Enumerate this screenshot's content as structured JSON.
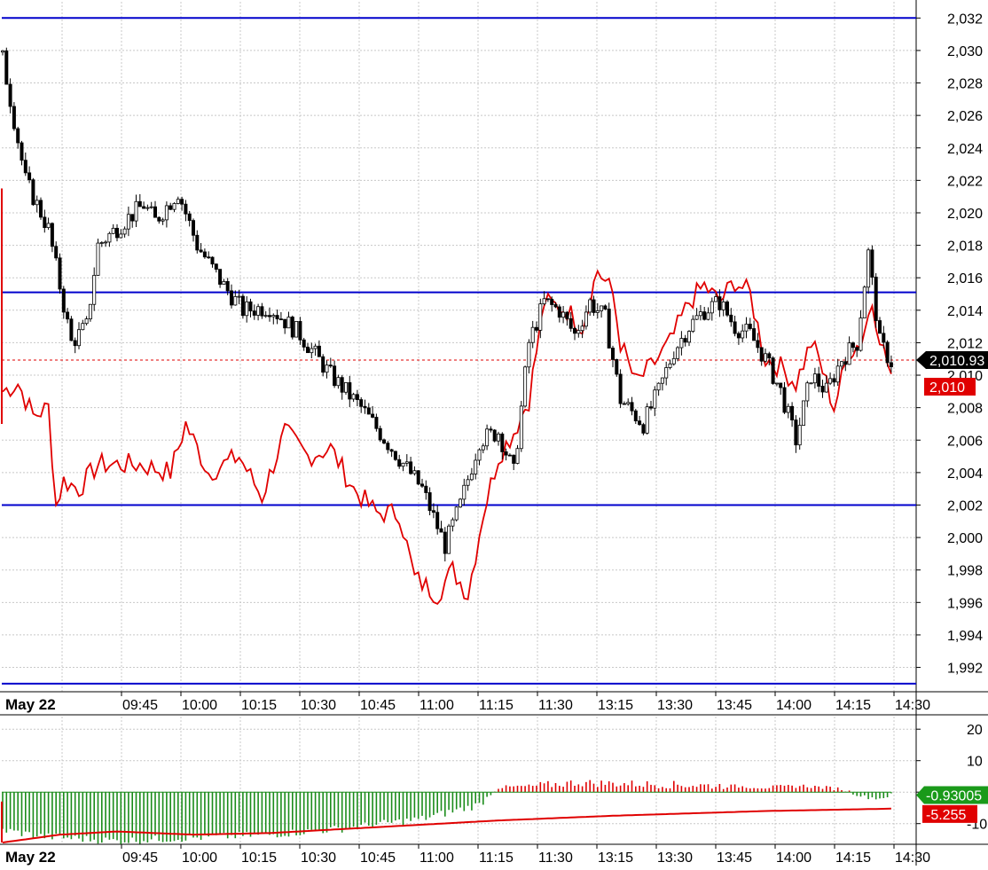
{
  "chart_data": [
    {
      "type": "candlestick",
      "panel": "price",
      "date_label": "May 22",
      "x_tick_labels": [
        "09:45",
        "10:00",
        "10:15",
        "10:30",
        "10:45",
        "11:00",
        "11:15",
        "11:30",
        "13:15",
        "13:30",
        "13:45",
        "14:00",
        "14:15",
        "14:30"
      ],
      "y_tick_labels": [
        "2,032",
        "2,030",
        "2,028",
        "2,026",
        "2,024",
        "2,022",
        "2,020",
        "2,018",
        "2,016",
        "2,014",
        "2,012",
        "2,010",
        "2,008",
        "2,006",
        "2,004",
        "2,002",
        "2,000",
        "1,998",
        "1,996",
        "1,994",
        "1,992"
      ],
      "ylim": [
        1990.5,
        2033.0
      ],
      "horizontal_lines": [
        2032.0,
        2015.1,
        2002.0,
        1991.0
      ],
      "last_price": 2010.93,
      "last_price_label": "2,010.93",
      "overlay_last_label": "2,010",
      "overlay_last_value": 2010.0,
      "overlay_color": "#e00000",
      "line_color": "#0000cc",
      "grid": true,
      "close_anchors": [
        [
          0,
          2029.5
        ],
        [
          6,
          2022.0
        ],
        [
          12,
          2019.0
        ],
        [
          18,
          2012.0
        ],
        [
          22,
          2013.0
        ],
        [
          25,
          2018.0
        ],
        [
          32,
          2019.5
        ],
        [
          37,
          2020.5
        ],
        [
          40,
          2019.5
        ],
        [
          46,
          2021.3
        ],
        [
          51,
          2018.0
        ],
        [
          58,
          2015.5
        ],
        [
          63,
          2014.0
        ],
        [
          70,
          2014.2
        ],
        [
          78,
          2012.5
        ],
        [
          86,
          2010.0
        ],
        [
          94,
          2008.0
        ],
        [
          102,
          2005.5
        ],
        [
          110,
          2003.0
        ],
        [
          116,
          1999.5
        ],
        [
          120,
          2002.0
        ],
        [
          125,
          2006.0
        ],
        [
          130,
          2006.5
        ],
        [
          134,
          2004.0
        ],
        [
          138,
          2012.0
        ],
        [
          142,
          2014.5
        ],
        [
          146,
          2014.0
        ],
        [
          150,
          2012.5
        ],
        [
          154,
          2014.5
        ],
        [
          158,
          2013.5
        ],
        [
          160,
          2011.0
        ],
        [
          162,
          2008.5
        ],
        [
          168,
          2007.0
        ],
        [
          172,
          2009.0
        ],
        [
          176,
          2011.5
        ],
        [
          180,
          2013.0
        ],
        [
          184,
          2014.0
        ],
        [
          188,
          2014.5
        ],
        [
          192,
          2013.0
        ],
        [
          196,
          2012.5
        ],
        [
          200,
          2011.0
        ],
        [
          204,
          2009.0
        ],
        [
          208,
          2006.0
        ],
        [
          212,
          2010.0
        ],
        [
          216,
          2009.0
        ],
        [
          220,
          2011.0
        ],
        [
          224,
          2012.0
        ],
        [
          227,
          2017.5
        ],
        [
          230,
          2012.0
        ],
        [
          233,
          2010.8
        ]
      ],
      "overlay_anchors": [
        [
          0,
          2009.0
        ],
        [
          4,
          2009.5
        ],
        [
          8,
          2007.5
        ],
        [
          12,
          2008.0
        ],
        [
          14,
          2002.0
        ],
        [
          16,
          2003.5
        ],
        [
          20,
          2003.0
        ],
        [
          25,
          2004.5
        ],
        [
          30,
          2004.5
        ],
        [
          36,
          2004.5
        ],
        [
          44,
          2004.0
        ],
        [
          48,
          2007.0
        ],
        [
          54,
          2004.0
        ],
        [
          62,
          2005.0
        ],
        [
          68,
          2002.5
        ],
        [
          74,
          2006.5
        ],
        [
          80,
          2005.0
        ],
        [
          86,
          2005.5
        ],
        [
          92,
          2003.0
        ],
        [
          98,
          2001.5
        ],
        [
          104,
          2001.5
        ],
        [
          108,
          1997.5
        ],
        [
          114,
          1996.5
        ],
        [
          118,
          1998.0
        ],
        [
          122,
          1996.5
        ],
        [
          126,
          2001.5
        ],
        [
          130,
          2005.0
        ],
        [
          134,
          2006.5
        ],
        [
          138,
          2008.5
        ],
        [
          142,
          2014.5
        ],
        [
          148,
          2014.0
        ],
        [
          152,
          2013.0
        ],
        [
          156,
          2016.5
        ],
        [
          160,
          2015.0
        ],
        [
          162,
          2012.0
        ],
        [
          166,
          2009.5
        ],
        [
          170,
          2010.5
        ],
        [
          175,
          2012.0
        ],
        [
          180,
          2014.5
        ],
        [
          184,
          2015.5
        ],
        [
          188,
          2014.5
        ],
        [
          192,
          2015.8
        ],
        [
          196,
          2015.0
        ],
        [
          200,
          2011.0
        ],
        [
          204,
          2010.5
        ],
        [
          208,
          2009.5
        ],
        [
          212,
          2012.0
        ],
        [
          214,
          2011.0
        ],
        [
          218,
          2008.0
        ],
        [
          222,
          2011.5
        ],
        [
          225,
          2012.0
        ],
        [
          228,
          2014.5
        ],
        [
          231,
          2011.5
        ],
        [
          233,
          2010.0
        ]
      ]
    },
    {
      "type": "histogram",
      "panel": "oscillator",
      "date_label": "May 22",
      "x_tick_labels": [
        "09:45",
        "10:00",
        "10:15",
        "10:30",
        "10:45",
        "11:00",
        "11:15",
        "11:30",
        "13:15",
        "13:30",
        "13:45",
        "14:00",
        "14:15",
        "14:30"
      ],
      "y_tick_labels": [
        "20",
        "10",
        "0",
        "-10"
      ],
      "ylim": [
        -16,
        24
      ],
      "last_value": -0.93005,
      "last_value_label": "-0.93005",
      "signal_last_value": -5.255,
      "signal_last_label": "-5.255",
      "positive_color": "#e00000",
      "negative_color": "#1a8c1a",
      "signal_color": "#e00000",
      "grid": true,
      "histogram_anchors": [
        [
          0,
          -12.0
        ],
        [
          10,
          -14.0
        ],
        [
          30,
          -15.5
        ],
        [
          50,
          -14.5
        ],
        [
          70,
          -13.5
        ],
        [
          90,
          -11.5
        ],
        [
          110,
          -8.5
        ],
        [
          125,
          -4.0
        ],
        [
          128,
          -0.5
        ],
        [
          130,
          1.5
        ],
        [
          140,
          2.0
        ],
        [
          150,
          3.0
        ],
        [
          170,
          2.5
        ],
        [
          190,
          2.0
        ],
        [
          200,
          1.5
        ],
        [
          210,
          2.0
        ],
        [
          220,
          1.0
        ],
        [
          226,
          -1.5
        ],
        [
          230,
          -2.0
        ],
        [
          233,
          -0.9
        ]
      ],
      "signal_anchors": [
        [
          0,
          -16.0
        ],
        [
          15,
          -13.5
        ],
        [
          30,
          -12.5
        ],
        [
          50,
          -13.5
        ],
        [
          70,
          -13.0
        ],
        [
          100,
          -11.0
        ],
        [
          130,
          -9.0
        ],
        [
          160,
          -7.5
        ],
        [
          200,
          -6.0
        ],
        [
          233,
          -5.25
        ]
      ]
    }
  ]
}
